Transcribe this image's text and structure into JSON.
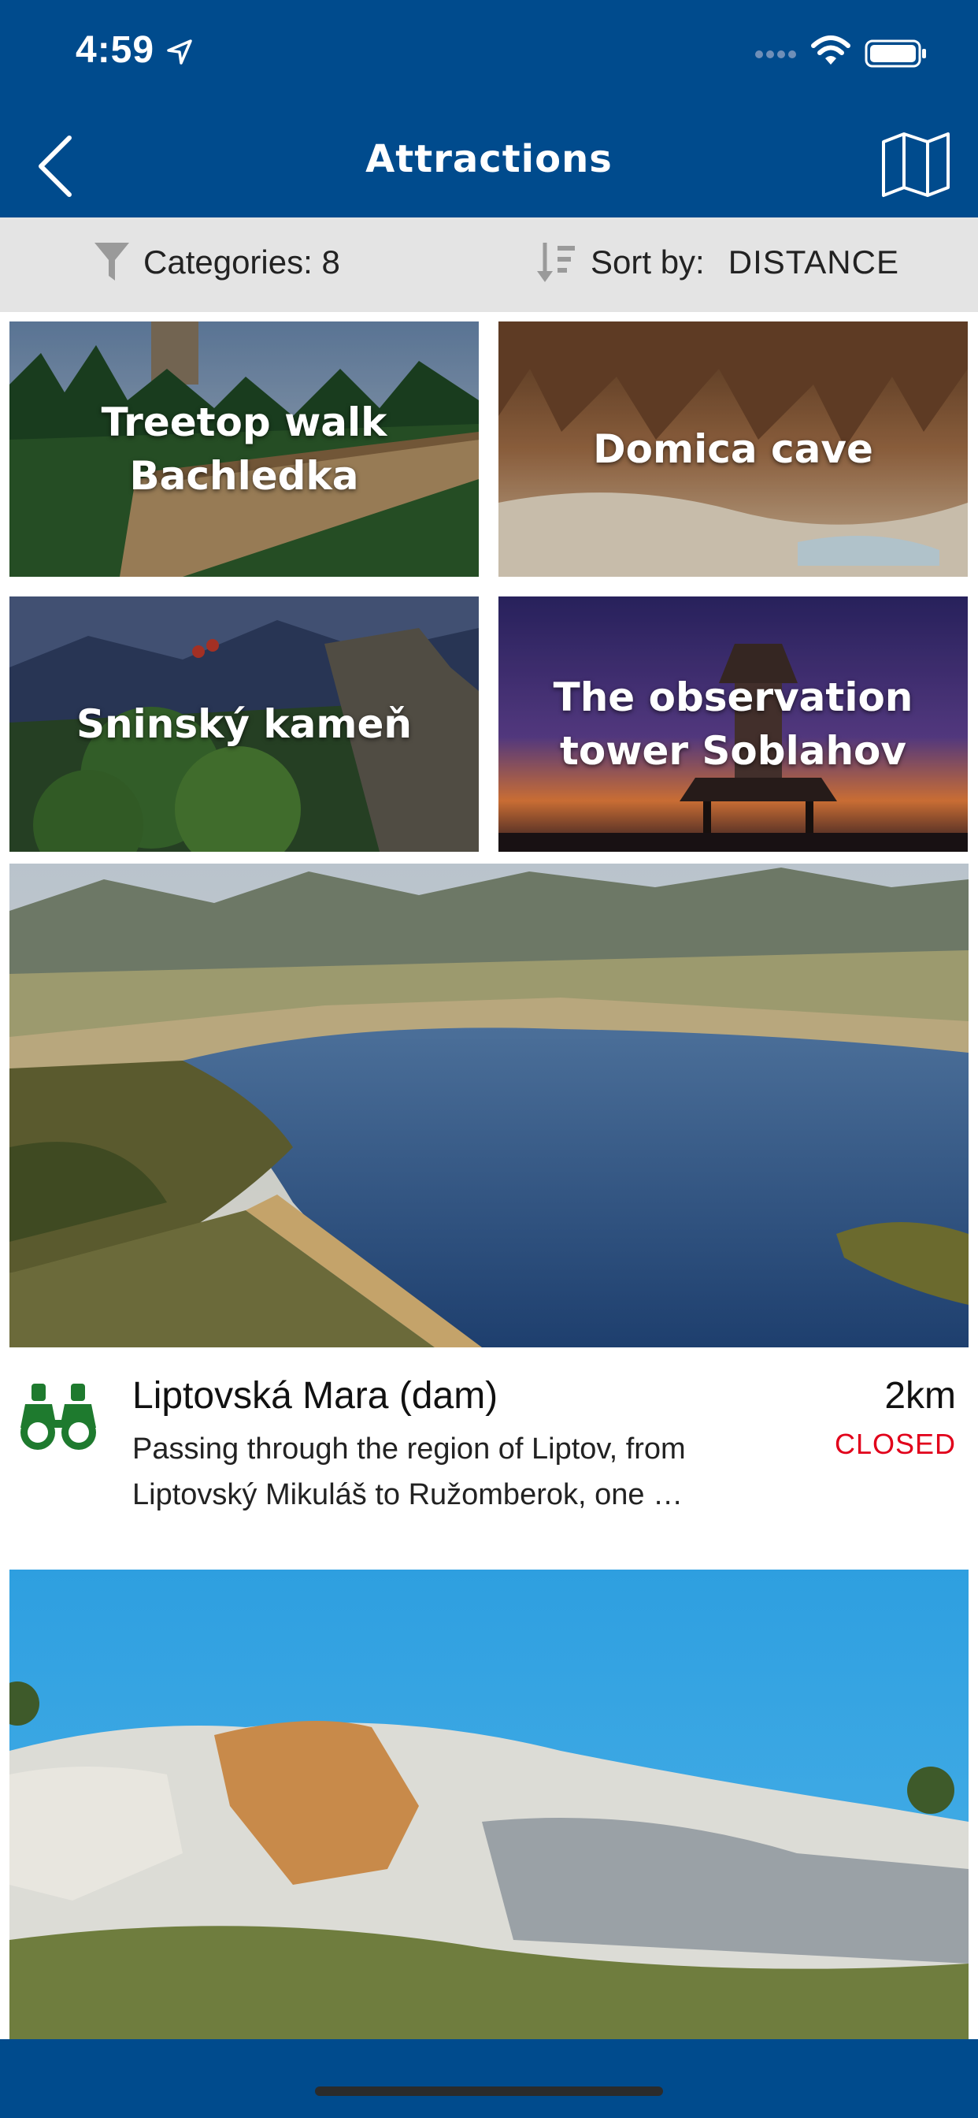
{
  "status_bar": {
    "time": "4:59"
  },
  "nav": {
    "title": "Attractions",
    "back_icon": "chevron-left-icon",
    "map_icon": "map-icon"
  },
  "filters": {
    "categories_label": "Categories: 8",
    "sort_label": "Sort by:",
    "sort_value": "DISTANCE"
  },
  "tiles": [
    {
      "label": "Treetop walk\nBachledka"
    },
    {
      "label": "Domica cave"
    },
    {
      "label": "Sninský kameň"
    },
    {
      "label": "The observation\ntower Soblahov"
    }
  ],
  "featured": {
    "title": "Liptovská Mara (dam)",
    "description": "Passing through the region of Liptov, from Liptovský Mikuláš to Ružomberok, one …",
    "distance": "2km",
    "status": "CLOSED",
    "status_color": "#e1001a",
    "icon": "binoculars-icon"
  },
  "colors": {
    "brand": "#004b8d",
    "filter_bg": "#e4e4e4",
    "icon_green": "#1e7a2e"
  }
}
